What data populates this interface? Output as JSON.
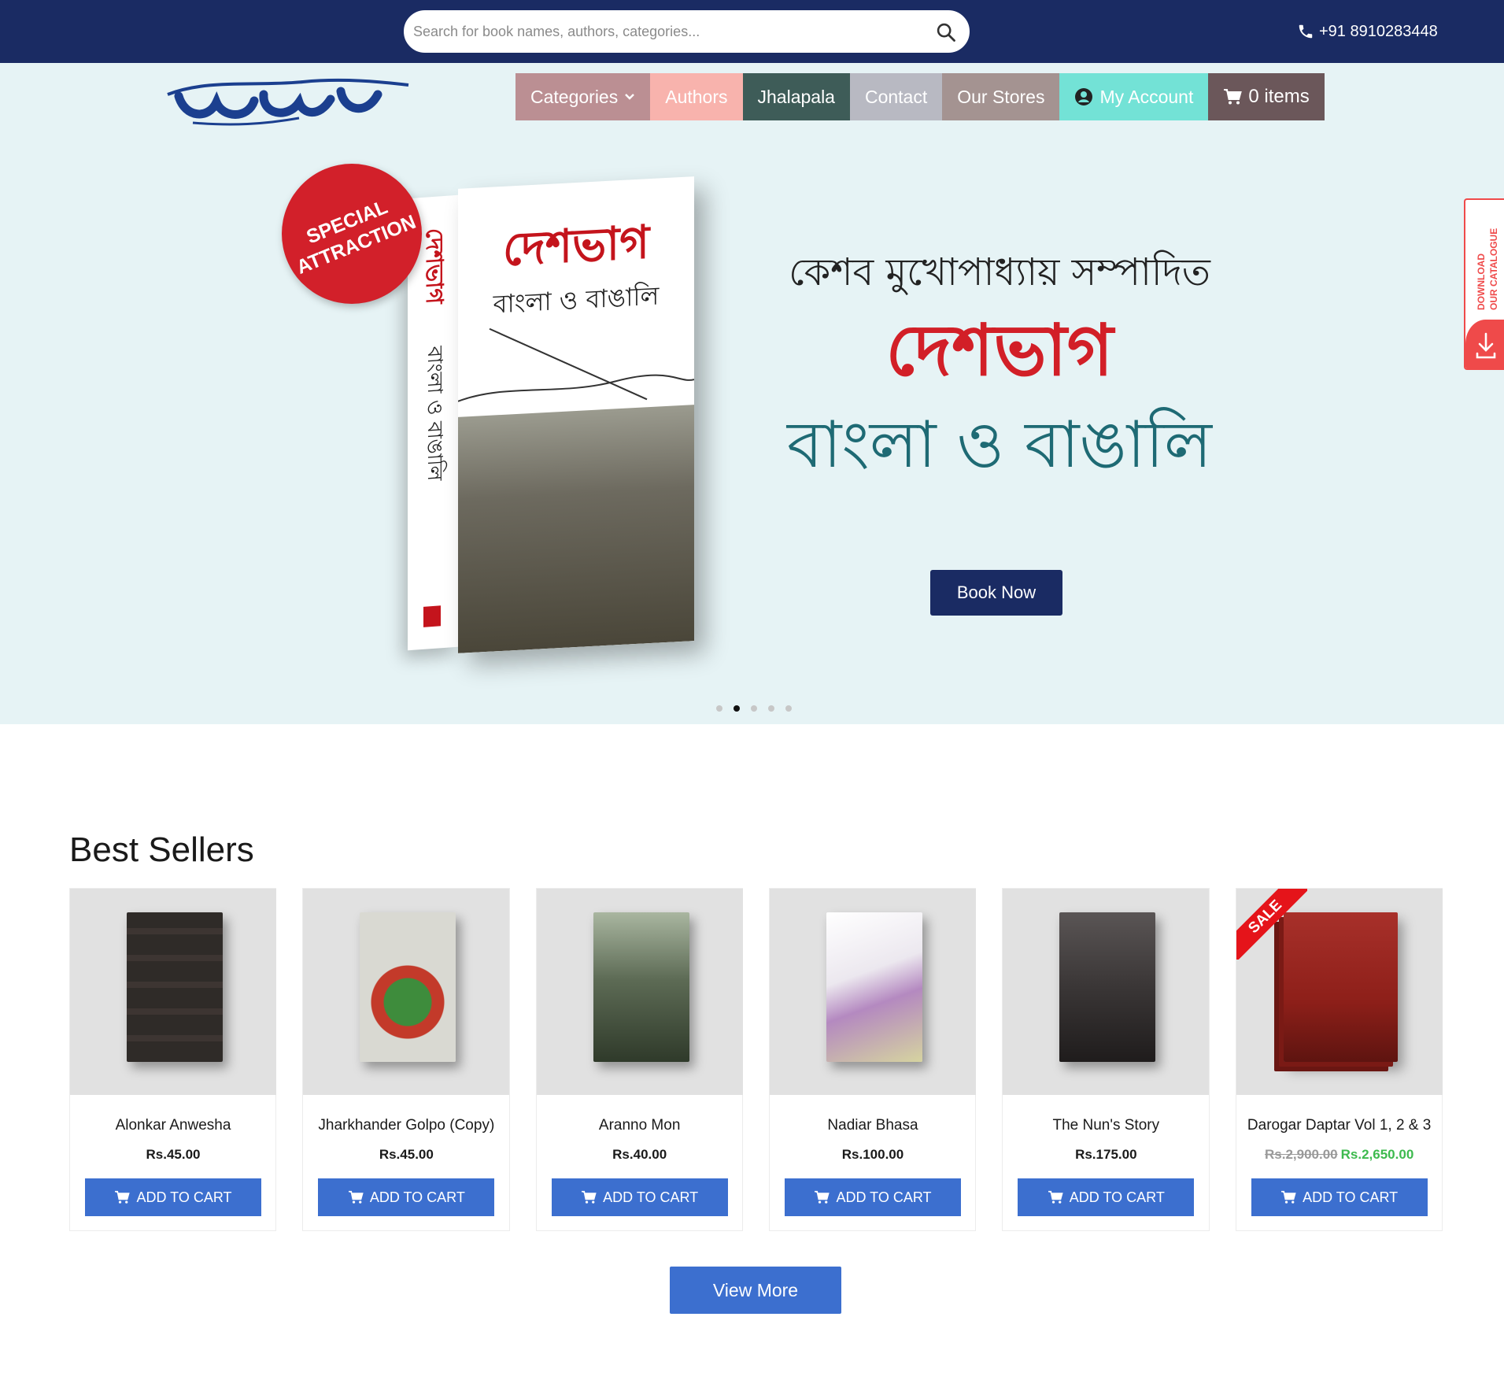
{
  "topbar": {
    "search_placeholder": "Search for book names, authors, categories...",
    "phone": "+91 8910283448"
  },
  "nav": {
    "categories": "Categories",
    "authors": "Authors",
    "jhalapala": "Jhalapala",
    "contact": "Contact",
    "stores": "Our Stores",
    "account": "My Account",
    "cart": "0 items"
  },
  "hero": {
    "badge": "SPECIAL ATTRACTION",
    "line1": "কেশব মুখোপাধ্যায় সম্পাদিত",
    "line2": "দেশভাগ",
    "line3": "বাংলা ও বাঙালি",
    "cta": "Book Now",
    "book_title": "দেশভাগ",
    "book_subtitle": "বাংলা ও বাঙালি",
    "slides": 5,
    "active_slide": 2
  },
  "catalogue_tab": {
    "line1": "DOWNLOAD",
    "line2": "OUR CATALOGUE"
  },
  "best_sellers": {
    "title": "Best Sellers",
    "add_to_cart": "ADD TO CART",
    "view_more": "View More",
    "products": [
      {
        "name": "Alonkar Anwesha",
        "price": "Rs.45.00",
        "cover_color": "#2f2b28",
        "sale": false
      },
      {
        "name": "Jharkhander Golpo (Copy)",
        "price": "Rs.45.00",
        "cover_color": "#d9d9d2",
        "sale": false
      },
      {
        "name": "Aranno Mon",
        "price": "Rs.40.00",
        "cover_color": "#5d6b55",
        "sale": false
      },
      {
        "name": "Nadiar Bhasa",
        "price": "Rs.100.00",
        "cover_color": "#ece8ef",
        "sale": false
      },
      {
        "name": "The Nun's Story",
        "price": "Rs.175.00",
        "cover_color": "#3a3636",
        "sale": false
      },
      {
        "name": "Darogar Daptar Vol 1, 2 & 3",
        "price_old": "Rs.2,900.00",
        "price": "Rs.2,650.00",
        "cover_color": "#8d1f19",
        "sale": true,
        "sale_label": "SALE"
      }
    ]
  },
  "colors": {
    "topbar": "#1a2b63",
    "hero_bg": "#e6f3f5",
    "button_blue": "#3c6fcf",
    "accent_red": "#d21f27"
  }
}
